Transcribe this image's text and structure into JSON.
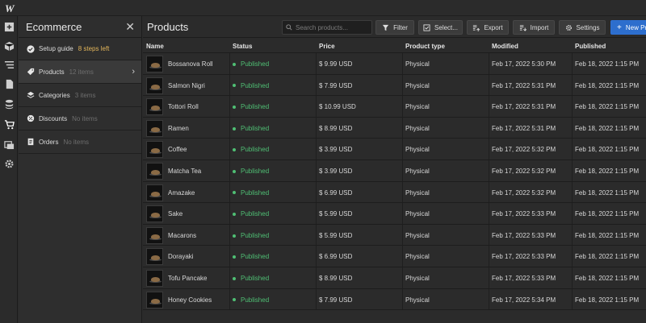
{
  "app": {
    "logo": "W"
  },
  "rail": {
    "icons": [
      "add-icon",
      "components-icon",
      "navigator-icon",
      "pages-icon",
      "cms-icon",
      "ecommerce-icon",
      "assets-icon",
      "settings-icon"
    ]
  },
  "panel": {
    "title": "Ecommerce",
    "close": "✕",
    "items": [
      {
        "label": "Setup guide",
        "sub": "8 steps left",
        "icon": "check-circle-icon"
      },
      {
        "label": "Products",
        "sub": "12 items",
        "icon": "tag-icon"
      },
      {
        "label": "Categories",
        "sub": "3 items",
        "icon": "diamond-icon"
      },
      {
        "label": "Discounts",
        "sub": "No items",
        "icon": "discount-icon"
      },
      {
        "label": "Orders",
        "sub": "No items",
        "icon": "orders-icon"
      }
    ],
    "chevron": "›"
  },
  "main": {
    "title": "Products",
    "search_placeholder": "Search products...",
    "buttons": {
      "filter": "Filter",
      "select": "Select...",
      "export": "Export",
      "import": "Import",
      "settings": "Settings",
      "new": "New Pr"
    },
    "accent": "#2d6ecd",
    "status_color": "#4fbf74"
  },
  "table": {
    "columns": [
      "Name",
      "Status",
      "Price",
      "Product type",
      "Modified",
      "Published"
    ],
    "rows": [
      {
        "name": "Bossanova Roll",
        "status": "Published",
        "price": "$ 9.99 USD",
        "type": "Physical",
        "modified": "Feb 17, 2022 5:30 PM",
        "published": "Feb 18, 2022 1:15 PM"
      },
      {
        "name": "Salmon Nigri",
        "status": "Published",
        "price": "$ 7.99 USD",
        "type": "Physical",
        "modified": "Feb 17, 2022 5:31 PM",
        "published": "Feb 18, 2022 1:15 PM"
      },
      {
        "name": "Tottori Roll",
        "status": "Published",
        "price": "$ 10.99 USD",
        "type": "Physical",
        "modified": "Feb 17, 2022 5:31 PM",
        "published": "Feb 18, 2022 1:15 PM"
      },
      {
        "name": "Ramen",
        "status": "Published",
        "price": "$ 8.99 USD",
        "type": "Physical",
        "modified": "Feb 17, 2022 5:31 PM",
        "published": "Feb 18, 2022 1:15 PM"
      },
      {
        "name": "Coffee",
        "status": "Published",
        "price": "$ 3.99 USD",
        "type": "Physical",
        "modified": "Feb 17, 2022 5:32 PM",
        "published": "Feb 18, 2022 1:15 PM"
      },
      {
        "name": "Matcha Tea",
        "status": "Published",
        "price": "$ 3.99 USD",
        "type": "Physical",
        "modified": "Feb 17, 2022 5:32 PM",
        "published": "Feb 18, 2022 1:15 PM"
      },
      {
        "name": "Amazake",
        "status": "Published",
        "price": "$ 6.99 USD",
        "type": "Physical",
        "modified": "Feb 17, 2022 5:32 PM",
        "published": "Feb 18, 2022 1:15 PM"
      },
      {
        "name": "Sake",
        "status": "Published",
        "price": "$ 5.99 USD",
        "type": "Physical",
        "modified": "Feb 17, 2022 5:33 PM",
        "published": "Feb 18, 2022 1:15 PM"
      },
      {
        "name": "Macarons",
        "status": "Published",
        "price": "$ 5.99 USD",
        "type": "Physical",
        "modified": "Feb 17, 2022 5:33 PM",
        "published": "Feb 18, 2022 1:15 PM"
      },
      {
        "name": "Dorayaki",
        "status": "Published",
        "price": "$ 6.99 USD",
        "type": "Physical",
        "modified": "Feb 17, 2022 5:33 PM",
        "published": "Feb 18, 2022 1:15 PM"
      },
      {
        "name": "Tofu Pancake",
        "status": "Published",
        "price": "$ 8.99 USD",
        "type": "Physical",
        "modified": "Feb 17, 2022 5:33 PM",
        "published": "Feb 18, 2022 1:15 PM"
      },
      {
        "name": "Honey Cookies",
        "status": "Published",
        "price": "$ 7.99 USD",
        "type": "Physical",
        "modified": "Feb 17, 2022 5:34 PM",
        "published": "Feb 18, 2022 1:15 PM"
      }
    ]
  }
}
